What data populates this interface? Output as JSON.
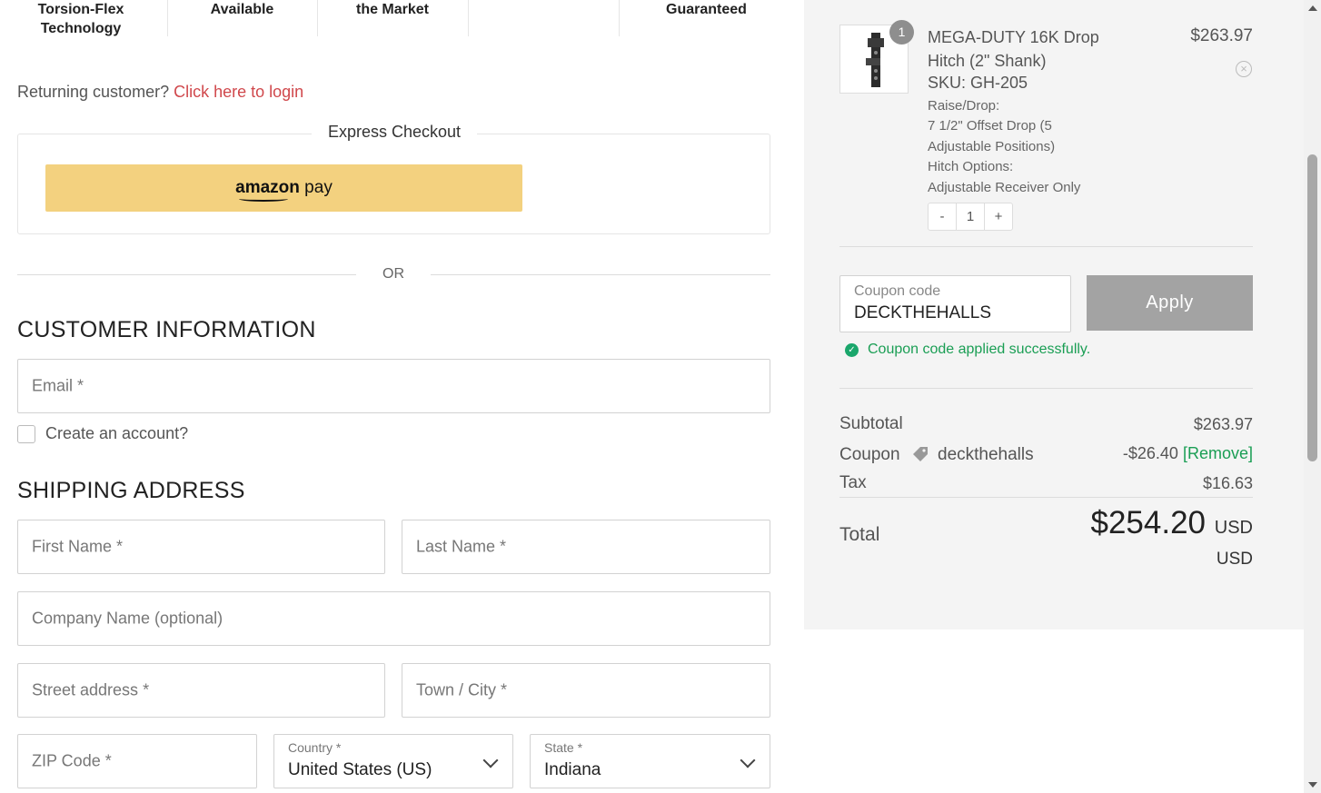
{
  "features": [
    {
      "line1": "Torsion-Flex",
      "line2": "Technology"
    },
    {
      "line1": "Available",
      "line2": ""
    },
    {
      "line1": "the Market",
      "line2": ""
    },
    {
      "line1": "",
      "line2": ""
    },
    {
      "line1": "Guaranteed",
      "line2": ""
    }
  ],
  "returning": {
    "text": "Returning customer?",
    "link": "Click here to login"
  },
  "express": {
    "title": "Express Checkout",
    "amazon_bold": "amazon",
    "amazon_rest": " pay"
  },
  "or_text": "OR",
  "customer": {
    "title": "CUSTOMER INFORMATION",
    "email_placeholder": "Email *",
    "create_account": "Create an account?"
  },
  "shipping": {
    "title": "SHIPPING ADDRESS",
    "first_name": "First Name *",
    "last_name": "Last Name *",
    "company": "Company Name (optional)",
    "street": "Street address *",
    "city": "Town / City *",
    "zip": "ZIP Code *",
    "country": {
      "label": "Country *",
      "value": "United States (US)"
    },
    "state": {
      "label": "State *",
      "value": "Indiana"
    }
  },
  "cart": {
    "item": {
      "quantity_badge": "1",
      "name": "MEGA-DUTY 16K Drop Hitch (2\" Shank)",
      "sku": "SKU: GH-205",
      "meta": [
        "Raise/Drop:",
        "7 1/2\" Offset Drop (5",
        "Adjustable Positions)",
        "Hitch Options:",
        "Adjustable Receiver Only"
      ],
      "price": "$263.97",
      "stepper": {
        "minus": "-",
        "qty": "1",
        "plus": "+"
      }
    },
    "coupon": {
      "label": "Coupon code",
      "value": "DECKTHEHALLS",
      "apply": "Apply",
      "success": "Coupon code applied successfully."
    },
    "totals": {
      "subtotal_label": "Subtotal",
      "subtotal_value": "$263.97",
      "coupon_label": "Coupon",
      "coupon_name": "deckthehalls",
      "coupon_value": "-$26.40",
      "coupon_remove": "[Remove]",
      "tax_label": "Tax",
      "tax_value": "$16.63",
      "total_label": "Total",
      "total_value": "$254.20",
      "total_currency_inline": "USD",
      "total_currency_below": "USD"
    }
  },
  "colors": {
    "link_red": "#d0484c",
    "success_green": "#1a9e54",
    "amazon_yellow": "#f3d17f",
    "apply_gray": "#a3a3a3"
  }
}
